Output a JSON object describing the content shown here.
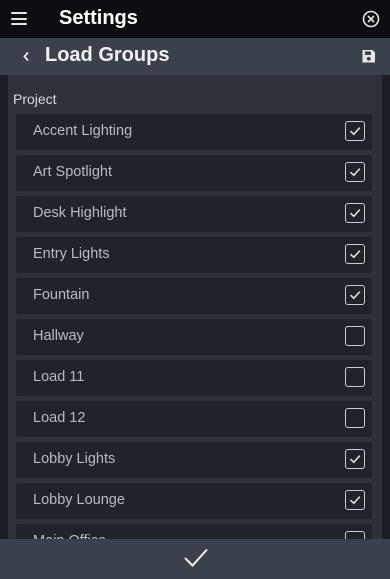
{
  "header": {
    "title": "Settings",
    "menu_icon": "hamburger-icon",
    "close_icon": "close-circle-icon"
  },
  "subheader": {
    "title": "Load Groups",
    "back_icon": "chevron-left-icon",
    "save_icon": "floppy-disk-icon"
  },
  "section": {
    "label": "Project"
  },
  "items": [
    {
      "label": "Accent Lighting",
      "checked": true
    },
    {
      "label": "Art Spotlight",
      "checked": true
    },
    {
      "label": "Desk Highlight",
      "checked": true
    },
    {
      "label": "Entry Lights",
      "checked": true
    },
    {
      "label": "Fountain",
      "checked": true
    },
    {
      "label": "Hallway",
      "checked": false
    },
    {
      "label": "Load 11",
      "checked": false
    },
    {
      "label": "Load 12",
      "checked": false
    },
    {
      "label": "Lobby Lights",
      "checked": true
    },
    {
      "label": "Lobby Lounge",
      "checked": true
    },
    {
      "label": "Main Office",
      "checked": false
    }
  ],
  "footer": {
    "confirm_icon": "checkmark-icon"
  },
  "colors": {
    "background": "#1b1e25",
    "topbar": "#0d0e11",
    "subbar": "#3b414b",
    "row": "#202329",
    "text": "#b7bcc4"
  }
}
